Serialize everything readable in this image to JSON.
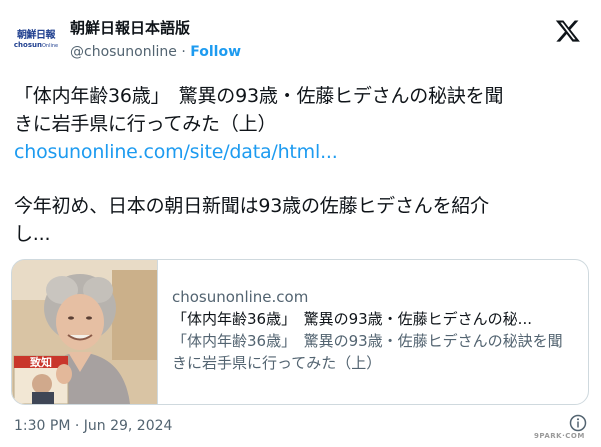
{
  "header": {
    "logo_jp": "朝鮮日報",
    "logo_en": "chosun",
    "logo_en_sub": "Online",
    "display_name": "朝鮮日報日本語版",
    "handle": "@chosunonline",
    "separator": "·",
    "follow_label": "Follow",
    "x_logo_icon": "x-logo-icon"
  },
  "tweet": {
    "line1": "「体内年齢36歳」　驚異の93歳・佐藤ヒデさんの秘訣を聞",
    "line2": "きに岩手県に行ってみた（上）",
    "link": "chosunonline.com/site/data/html...",
    "line3": "今年初め、日本の朝日新聞は93歳の佐藤ヒデさんを紹介",
    "line4": "し..."
  },
  "card": {
    "domain": "chosunonline.com",
    "title": "「体内年齢36歳」　驚異の93歳・佐藤ヒデさんの秘...",
    "desc": "「体内年齢36歳」　驚異の93歳・佐藤ヒデさんの秘訣を聞きに岩手県に行ってみた（上）",
    "book_text_top": "致知",
    "book_text_side": "致"
  },
  "footer": {
    "timestamp": "1:30 PM · Jun 29, 2024",
    "info_icon": "info-icon",
    "watermark": "9PARK·COM"
  },
  "colors": {
    "accent": "#1d9bf0",
    "text": "#0f1419",
    "muted": "#536471",
    "border": "#cfd9de"
  }
}
